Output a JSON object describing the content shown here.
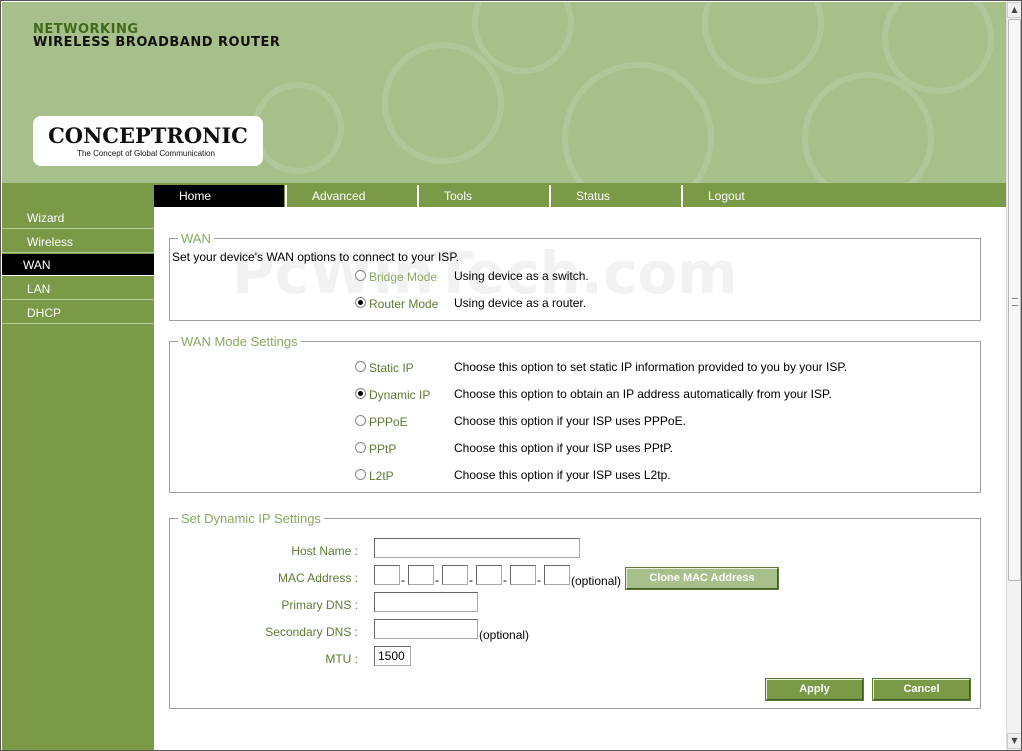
{
  "header": {
    "line1": "NETWORKING",
    "line2": "WIRELESS BROADBAND ROUTER",
    "logo_name": "CONCEPTRONIC",
    "logo_tagline": "The Concept of Global Communication"
  },
  "colors": {
    "header_bg": "#a7bf8a",
    "menu_green": "#7a9a47",
    "label_green": "#5d7a35",
    "legend_green": "#8aa862",
    "active_bg": "#000000"
  },
  "watermark": "PcWinTech.com",
  "sidebar": {
    "items": [
      {
        "label": "Wizard"
      },
      {
        "label": "Wireless"
      },
      {
        "label": "WAN",
        "active": true
      },
      {
        "label": "LAN"
      },
      {
        "label": "DHCP"
      }
    ]
  },
  "nav": {
    "tabs": [
      {
        "label": "Home",
        "active": true
      },
      {
        "label": "Advanced"
      },
      {
        "label": "Tools"
      },
      {
        "label": "Status"
      },
      {
        "label": "Logout"
      }
    ]
  },
  "wan": {
    "legend": "WAN",
    "intro": "Set your device's WAN options to connect to your ISP.",
    "options": [
      {
        "label": "Bridge Mode",
        "desc": "Using device as a switch.",
        "checked": false
      },
      {
        "label": "Router Mode",
        "desc": "Using device as a router.",
        "checked": true
      }
    ]
  },
  "wan_mode": {
    "legend": "WAN Mode Settings",
    "options": [
      {
        "label": "Static IP",
        "desc": "Choose this option to set static IP information provided to you by your ISP.",
        "checked": false
      },
      {
        "label": "Dynamic IP",
        "desc": "Choose this option to obtain an IP address automatically from your ISP.",
        "checked": true
      },
      {
        "label": "PPPoE",
        "desc": "Choose this option if your ISP uses PPPoE.",
        "checked": false
      },
      {
        "label": "PPtP",
        "desc": "Choose this option if your ISP uses PPtP.",
        "checked": false
      },
      {
        "label": "L2tP",
        "desc": "Choose this option if your ISP uses L2tp.",
        "checked": false
      }
    ]
  },
  "dynamic": {
    "legend": "Set Dynamic IP Settings",
    "host_name_label": "Host Name :",
    "host_name_value": "",
    "mac_label": "MAC Address :",
    "mac_segments": [
      "",
      "",
      "",
      "",
      "",
      ""
    ],
    "optional": "(optional)",
    "clone_mac": "Clone MAC Address",
    "primary_dns_label": "Primary DNS :",
    "primary_dns_value": "",
    "secondary_dns_label": "Secondary DNS :",
    "secondary_dns_value": "",
    "mtu_label": "MTU :",
    "mtu_value": "1500",
    "dash": "-"
  },
  "actions": {
    "apply": "Apply",
    "cancel": "Cancel"
  },
  "icons": {
    "scroll_up": "scroll-up-arrow-icon",
    "scroll_down": "scroll-down-arrow-icon"
  }
}
